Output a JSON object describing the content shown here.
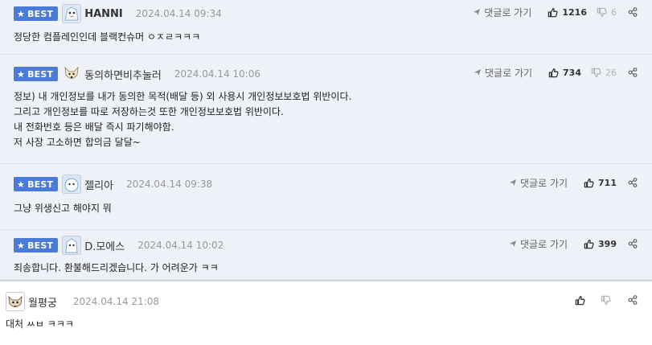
{
  "reply_label": "댓글로 가기",
  "best_label": "BEST",
  "comments": [
    {
      "nickname": "HANNI",
      "date": "2024.04.14 09:34",
      "upvotes": "1216",
      "downvotes": "6",
      "lines": [
        "정당한 컴플레인인데 블랙컨슈머 ㅇㅈㄹㅋㅋㅋ"
      ]
    },
    {
      "nickname": "동의하면비추눌러",
      "date": "2024.04.14 10:06",
      "upvotes": "734",
      "downvotes": "26",
      "lines": [
        "정보) 내 개인정보를 내가 동의한 목적(배달 등) 외 사용시 개인정보보호법 위반이다.",
        "그리고 개인정보를 따로 저장하는것 또한 개인정보보호법 위반이다.",
        "내 전화번호 등은 배달 즉시 파기해야함.",
        "저 사장 고소하면 합의금 달달~"
      ]
    },
    {
      "nickname": "젤리아",
      "date": "2024.04.14 09:38",
      "upvotes": "711",
      "downvotes": "",
      "lines": [
        "그냥 위생신고 해야지 뭐"
      ]
    },
    {
      "nickname": "D.모에스",
      "date": "2024.04.14 10:02",
      "upvotes": "399",
      "downvotes": "",
      "lines": [
        "죄송합니다. 환불해드리겠습니다. 가 어려운가 ㅋㅋ"
      ]
    },
    {
      "nickname": "월평궁",
      "date": "2024.04.14 21:08",
      "lines": [
        "대처 ㅆㅂ ㅋㅋㅋ"
      ]
    }
  ],
  "colors": {
    "best_bg": "#eef1f8",
    "badge": "#4a7bd8",
    "date": "#999999"
  },
  "icons": {
    "badge": "star-icon",
    "reply": "reply-arrow-icon",
    "upvote": "thumbs-up-icon",
    "downvote": "thumbs-down-icon",
    "more": "more-share-icon"
  }
}
